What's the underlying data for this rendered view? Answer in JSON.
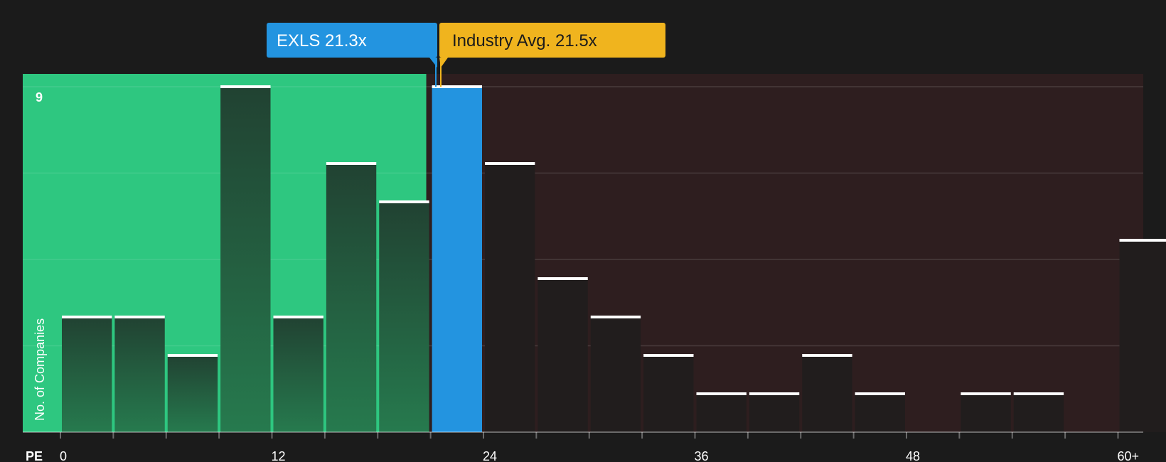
{
  "chart_data": {
    "type": "bar",
    "title": "",
    "xlabel": "PE",
    "ylabel": "No. of Companies",
    "ylim": [
      0,
      9
    ],
    "y_ticks_labeled": [
      9
    ],
    "x_tick_labels": [
      "0",
      "12",
      "24",
      "36",
      "48",
      "60+"
    ],
    "bin_width": 3,
    "bins": [
      {
        "x_start": 0,
        "count": 3
      },
      {
        "x_start": 3,
        "count": 3
      },
      {
        "x_start": 6,
        "count": 2
      },
      {
        "x_start": 9,
        "count": 9
      },
      {
        "x_start": 12,
        "count": 3
      },
      {
        "x_start": 15,
        "count": 7
      },
      {
        "x_start": 18,
        "count": 6
      },
      {
        "x_start": 21,
        "count": 9
      },
      {
        "x_start": 24,
        "count": 7
      },
      {
        "x_start": 27,
        "count": 4
      },
      {
        "x_start": 30,
        "count": 3
      },
      {
        "x_start": 33,
        "count": 2
      },
      {
        "x_start": 36,
        "count": 1
      },
      {
        "x_start": 39,
        "count": 1
      },
      {
        "x_start": 42,
        "count": 2
      },
      {
        "x_start": 45,
        "count": 1
      },
      {
        "x_start": 48,
        "count": 0
      },
      {
        "x_start": 51,
        "count": 1
      },
      {
        "x_start": 54,
        "count": 1
      },
      {
        "x_start": 57,
        "count": 0
      },
      {
        "x_start": 60,
        "count": 5
      }
    ],
    "highlight_bin_x_start": 21,
    "company": {
      "label": "EXLS 21.3x",
      "value": 21.3,
      "color": "#2394e0"
    },
    "industry": {
      "label": "Industry Avg. 21.5x",
      "value": 21.5,
      "color": "#f0b41e"
    },
    "colors": {
      "below_region": "#2ec780",
      "above_region": "#2e1e1f",
      "bar_below_top": "#214232",
      "bar_below_bottom": "#267a4e",
      "bar_above": "#211d1d",
      "highlight": "#2394e0"
    }
  }
}
